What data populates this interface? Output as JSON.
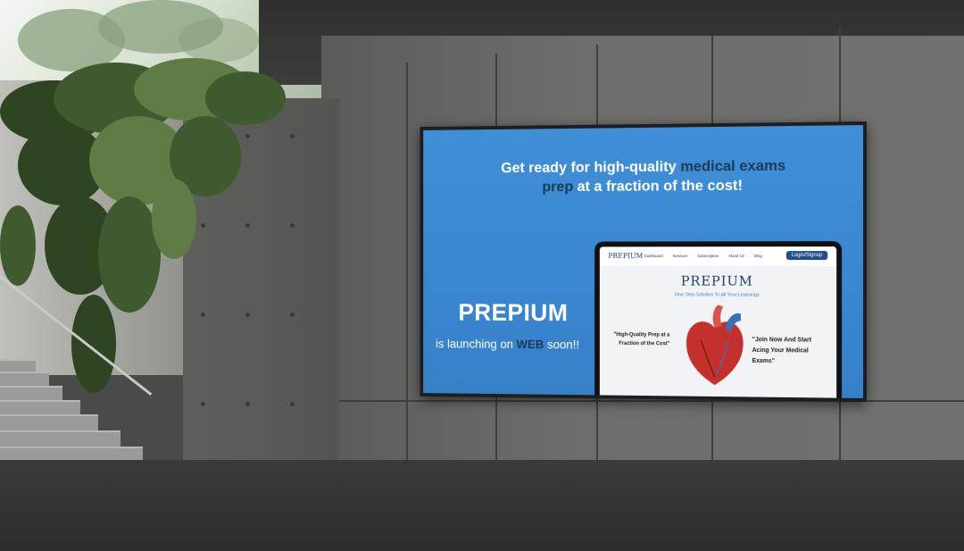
{
  "billboard": {
    "headline_line1_pre": "Get ready for high-quality ",
    "headline_line1_accent": "medical exams",
    "headline_line2_accent": "prep",
    "headline_line2_post": " at a fraction of the cost!",
    "brand": "PREPIUM",
    "tagline_pre": "is launching on ",
    "tagline_accent": "WEB",
    "tagline_post": " soon!!"
  },
  "tablet": {
    "logo": "PREPIUM",
    "nav_items": [
      "Dashboard",
      "Services",
      "Subscription",
      "About Us",
      "Blog"
    ],
    "login_label": "Login/Signup",
    "brand": "PREPIUM",
    "subtitle": "One Step Solution To All Your Learnings",
    "quote_left": "\"High-Quality Prep at a Fraction of the Cost\"",
    "quote_right": "\"Join Now And Start Acing Your Medical Exams\""
  },
  "colors": {
    "screen_blue": "#3a86cf",
    "accent_navy": "#1b3a5a",
    "button_blue": "#1f4f8f"
  }
}
